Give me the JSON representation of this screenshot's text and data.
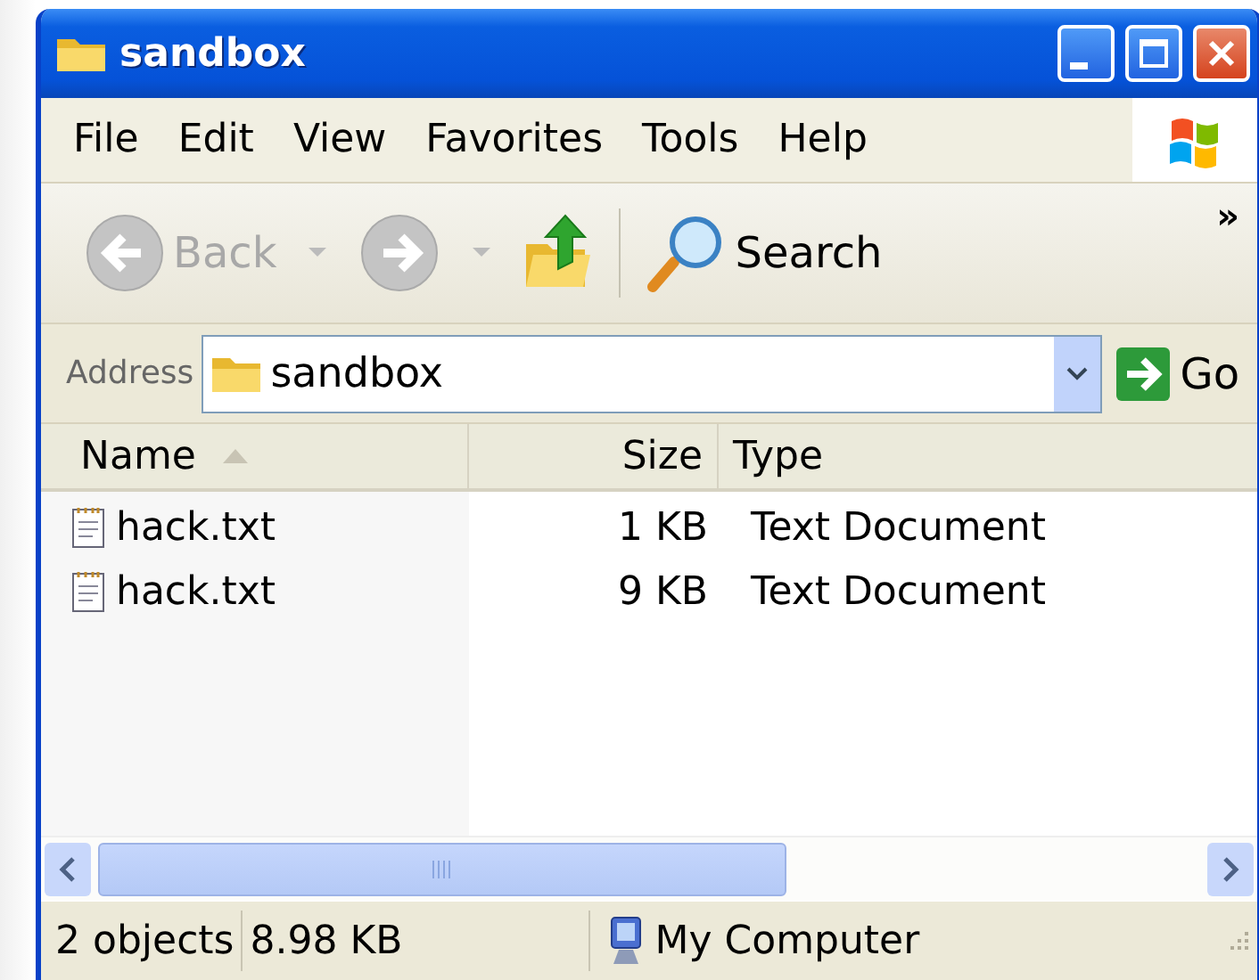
{
  "window": {
    "title": "sandbox"
  },
  "menu": [
    "File",
    "Edit",
    "View",
    "Favorites",
    "Tools",
    "Help"
  ],
  "toolbar": {
    "back": {
      "label": "Back",
      "disabled": true
    },
    "forward": {
      "disabled": true
    },
    "search": {
      "label": "Search"
    },
    "overflow": "»"
  },
  "address": {
    "label": "Address",
    "value": "sandbox",
    "go": "Go"
  },
  "columns": [
    {
      "label": "Name",
      "sorted": true
    },
    {
      "label": "Size",
      "sorted": false
    },
    {
      "label": "Type",
      "sorted": false
    }
  ],
  "rows": [
    {
      "name": "hack.txt",
      "size": "1 KB",
      "type": "Text Document"
    },
    {
      "name": "hack.txt",
      "size": "9 KB",
      "type": "Text Document"
    }
  ],
  "status_bar": {
    "count": "2 objects",
    "size": "8.98 KB",
    "zone": "My Computer"
  }
}
